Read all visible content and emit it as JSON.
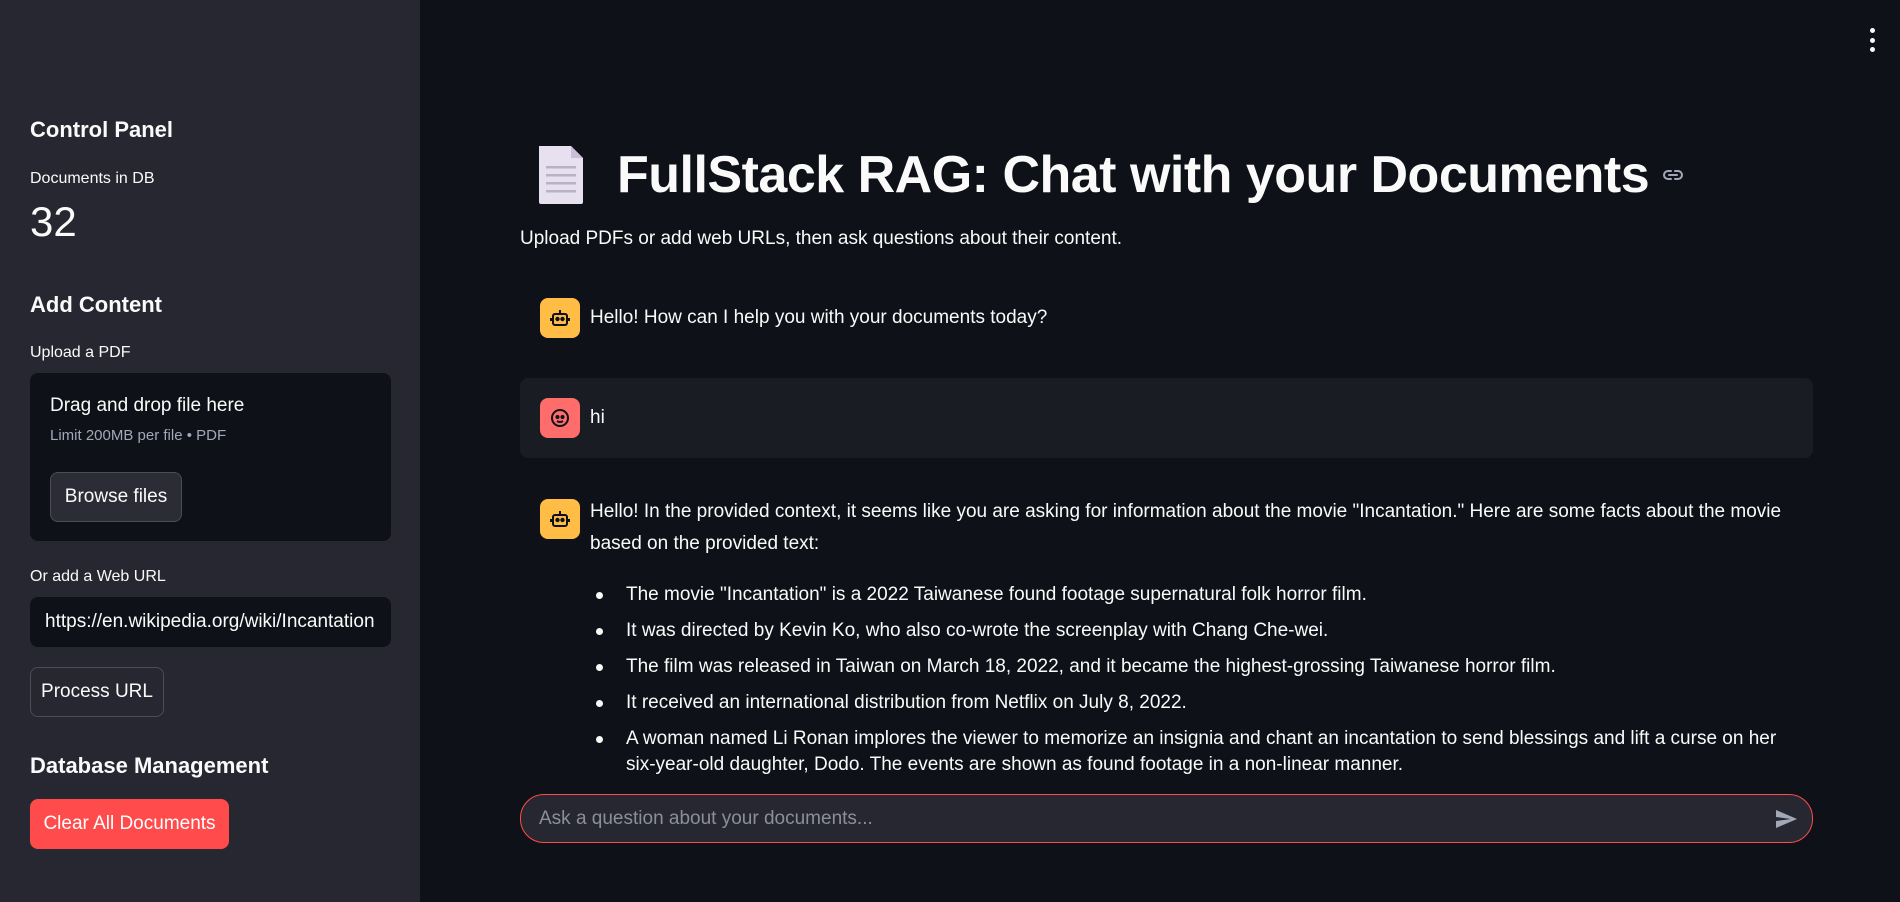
{
  "sidebar": {
    "control_panel_title": "Control Panel",
    "documents_label": "Documents in DB",
    "documents_count": "32",
    "add_content_title": "Add Content",
    "upload_label": "Upload a PDF",
    "uploader": {
      "title": "Drag and drop file here",
      "subtitle": "Limit 200MB per file • PDF",
      "browse_label": "Browse files"
    },
    "url_label": "Or add a Web URL",
    "url_value": "https://en.wikipedia.org/wiki/Incantation",
    "process_label": "Process URL",
    "db_title": "Database Management",
    "clear_label": "Clear All Documents"
  },
  "main": {
    "title": "FullStack RAG: Chat with your Documents",
    "subtitle": "Upload PDFs or add web URLs, then ask questions about their content.",
    "messages": [
      {
        "role": "assistant",
        "text": "Hello! How can I help you with your documents today?"
      },
      {
        "role": "user",
        "text": "hi"
      },
      {
        "role": "assistant",
        "text": "Hello! In the provided context, it seems like you are asking for information about the movie \"Incantation.\" Here are some facts about the movie based on the provided text:",
        "bullets": [
          "The movie \"Incantation\" is a 2022 Taiwanese found footage supernatural folk horror film.",
          "It was directed by Kevin Ko, who also co-wrote the screenplay with Chang Che-wei.",
          "The film was released in Taiwan on March 18, 2022, and it became the highest-grossing Taiwanese horror film.",
          "It received an international distribution from Netflix on July 8, 2022.",
          "A woman named Li Ronan implores the viewer to memorize an insignia and chant an incantation to send blessings and lift a curse on her six-year-old daughter, Dodo. The events are shown as found footage in a non-linear manner."
        ]
      }
    ],
    "chat_placeholder": "Ask a question about your documents..."
  },
  "colors": {
    "accent": "#ff4b4b",
    "sidebar_bg": "#262730",
    "main_bg": "#0e1117",
    "bot_avatar": "#ffbd45",
    "user_avatar": "#ff6c6c"
  },
  "icons": {
    "page_icon": "document-icon",
    "bot_avatar": "robot-icon",
    "user_avatar": "face-icon",
    "send": "send-icon",
    "menu": "kebab-menu-icon",
    "anchor": "link-icon"
  }
}
